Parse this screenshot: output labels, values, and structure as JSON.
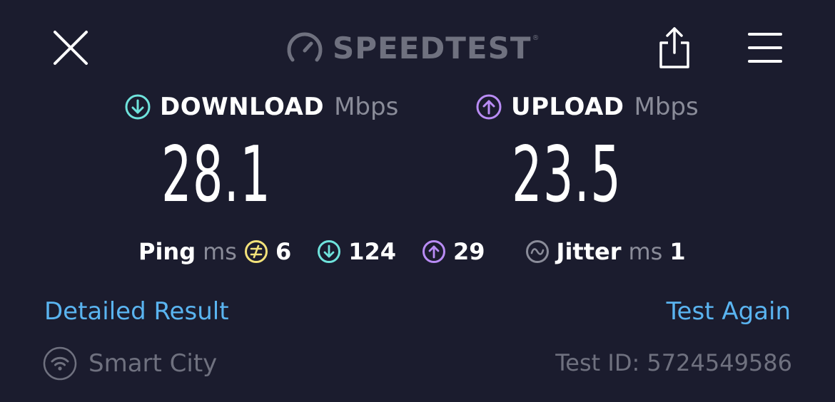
{
  "header": {
    "brand": "SPEEDTEST",
    "brand_mark": "®",
    "icons": {
      "close": "close-icon",
      "logo": "speedometer-icon",
      "share": "share-icon",
      "menu": "hamburger-menu-icon"
    }
  },
  "download": {
    "label": "DOWNLOAD",
    "unit": "Mbps",
    "value": "28.1",
    "icon": "arrow-down-circle-icon",
    "color": "#6fe3dc"
  },
  "upload": {
    "label": "UPLOAD",
    "unit": "Mbps",
    "value": "23.5",
    "icon": "arrow-up-circle-icon",
    "color": "#b98cf5"
  },
  "ping": {
    "label": "Ping",
    "unit": "ms",
    "idle": "6",
    "download": "124",
    "upload": "29",
    "idle_color": "#f3e27a"
  },
  "jitter": {
    "label": "Jitter",
    "unit": "ms",
    "value": "1"
  },
  "links": {
    "detailed": "Detailed Result",
    "again": "Test Again",
    "color": "#5ab4f0"
  },
  "footer": {
    "provider": "Smart City",
    "test_id": "Test ID: 5724549586"
  }
}
